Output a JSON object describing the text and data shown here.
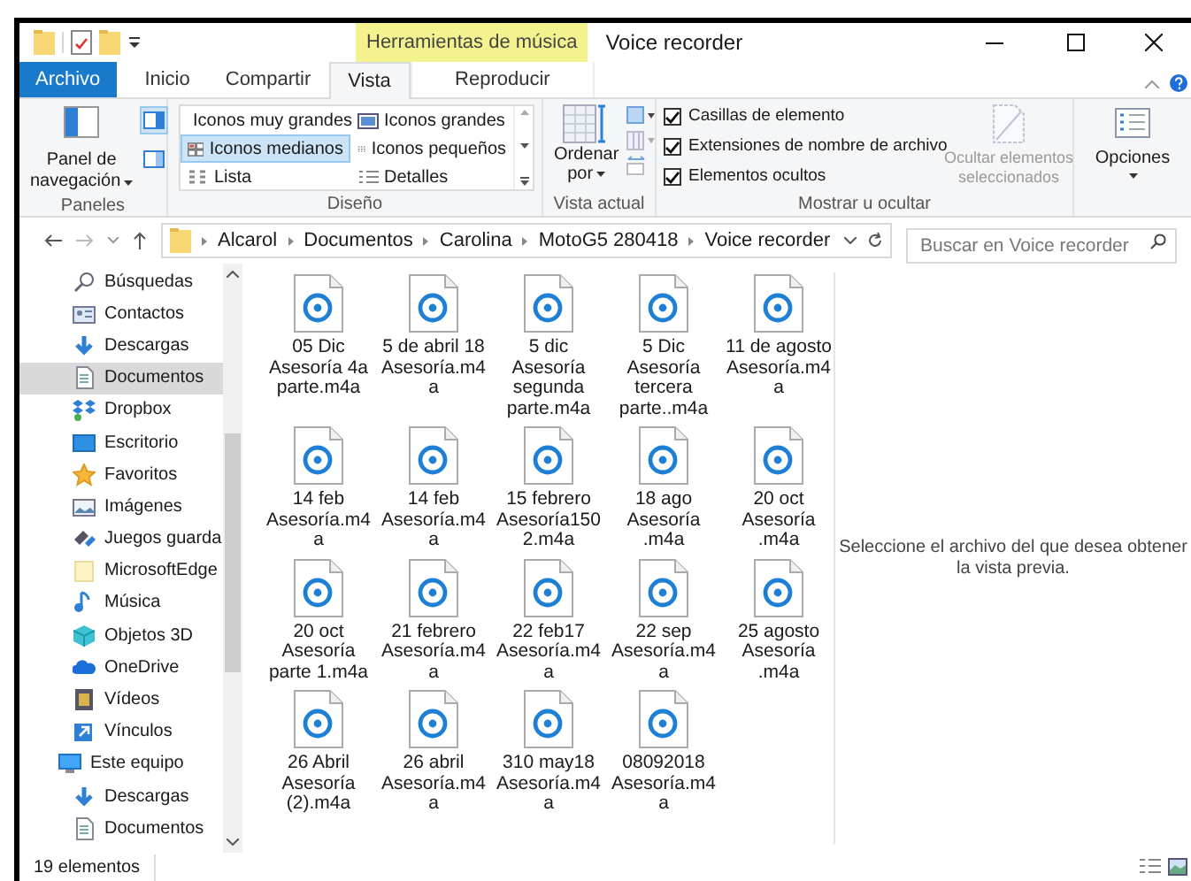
{
  "window": {
    "title": "Voice recorder",
    "context_tab": "Herramientas de música"
  },
  "tabs": [
    {
      "label": "Archivo",
      "kind": "file",
      "selected": false
    },
    {
      "label": "Inicio",
      "kind": "tab",
      "selected": false
    },
    {
      "label": "Compartir",
      "kind": "tab",
      "selected": false
    },
    {
      "label": "Vista",
      "kind": "tab",
      "selected": true
    },
    {
      "label": "Reproducir",
      "kind": "context",
      "selected": false
    }
  ],
  "ribbon": {
    "panes": {
      "label": "Paneles",
      "nav_button": [
        "Panel de",
        "navegación"
      ],
      "preview_pane_on": true,
      "details_pane_on": false
    },
    "layout": {
      "label": "Diseño",
      "options": [
        {
          "label": "Iconos muy grandes",
          "selected": false
        },
        {
          "label": "Iconos grandes",
          "selected": false
        },
        {
          "label": "Iconos medianos",
          "selected": true
        },
        {
          "label": "Iconos pequeños",
          "selected": false
        },
        {
          "label": "Lista",
          "selected": false
        },
        {
          "label": "Detalles",
          "selected": false
        }
      ]
    },
    "current_view": {
      "label": "Vista actual",
      "sort_button": [
        "Ordenar",
        "por"
      ]
    },
    "show_hide": {
      "label": "Mostrar u ocultar",
      "checkboxes": [
        {
          "label": "Casillas de elemento",
          "checked": true
        },
        {
          "label": "Extensiones de nombre de archivo",
          "checked": true
        },
        {
          "label": "Elementos ocultos",
          "checked": true
        }
      ],
      "hide_button": {
        "label": [
          "Ocultar elementos",
          "seleccionados"
        ],
        "disabled": true
      }
    },
    "options": {
      "label": "Opciones"
    }
  },
  "address": {
    "path": [
      "Alcarol",
      "Documentos",
      "Carolina",
      "MotoG5 280418",
      "Voice recorder"
    ]
  },
  "search": {
    "placeholder": "Buscar en Voice recorder"
  },
  "sidebar": {
    "quick_access": [
      {
        "label": "Búsquedas",
        "selected": false
      },
      {
        "label": "Contactos",
        "selected": false
      },
      {
        "label": "Descargas",
        "selected": false
      },
      {
        "label": "Documentos",
        "selected": true
      },
      {
        "label": "Dropbox",
        "selected": false
      },
      {
        "label": "Escritorio",
        "selected": false
      },
      {
        "label": "Favoritos",
        "selected": false
      },
      {
        "label": "Imágenes",
        "selected": false
      },
      {
        "label": "Juegos guarda",
        "selected": false
      },
      {
        "label": "MicrosoftEdge",
        "selected": false
      },
      {
        "label": "Música",
        "selected": false
      },
      {
        "label": "Objetos 3D",
        "selected": false
      },
      {
        "label": "OneDrive",
        "selected": false
      },
      {
        "label": "Vídeos",
        "selected": false
      },
      {
        "label": "Vínculos",
        "selected": false
      }
    ],
    "this_pc": {
      "label": "Este equipo",
      "selected": false,
      "children": [
        {
          "label": "Descargas",
          "selected": false
        },
        {
          "label": "Documentos",
          "selected": false
        }
      ]
    }
  },
  "files": [
    "05 Dic Asesoría 4a parte.m4a",
    "5 de abril 18 Asesoría.m4a",
    "5 dic Asesoría segunda parte.m4a",
    "5 Dic Asesoría tercera parte..m4a",
    "11 de agosto Asesoría.m4a",
    "14 feb Asesoría.m4a",
    "14 feb Asesoría.m4a",
    "15 febrero Asesoría1502.m4a",
    "18 ago Asesoría .m4a",
    "20 oct Asesoría .m4a",
    "20 oct Asesoría parte 1.m4a",
    "21 febrero Asesoría.m4a",
    "22 feb17 Asesoría.m4a",
    "22 sep Asesoría.m4a",
    "25 agosto Asesoría .m4a",
    "26 Abril Asesoría (2).m4a",
    "26 abril Asesoría.m4a",
    "310 may18 Asesoría.m4a",
    "08092018 Asesoría.m4a"
  ],
  "preview": {
    "message": "Seleccione el archivo del que desea obtener la vista previa."
  },
  "status_bar": {
    "count": "19 elementos"
  }
}
